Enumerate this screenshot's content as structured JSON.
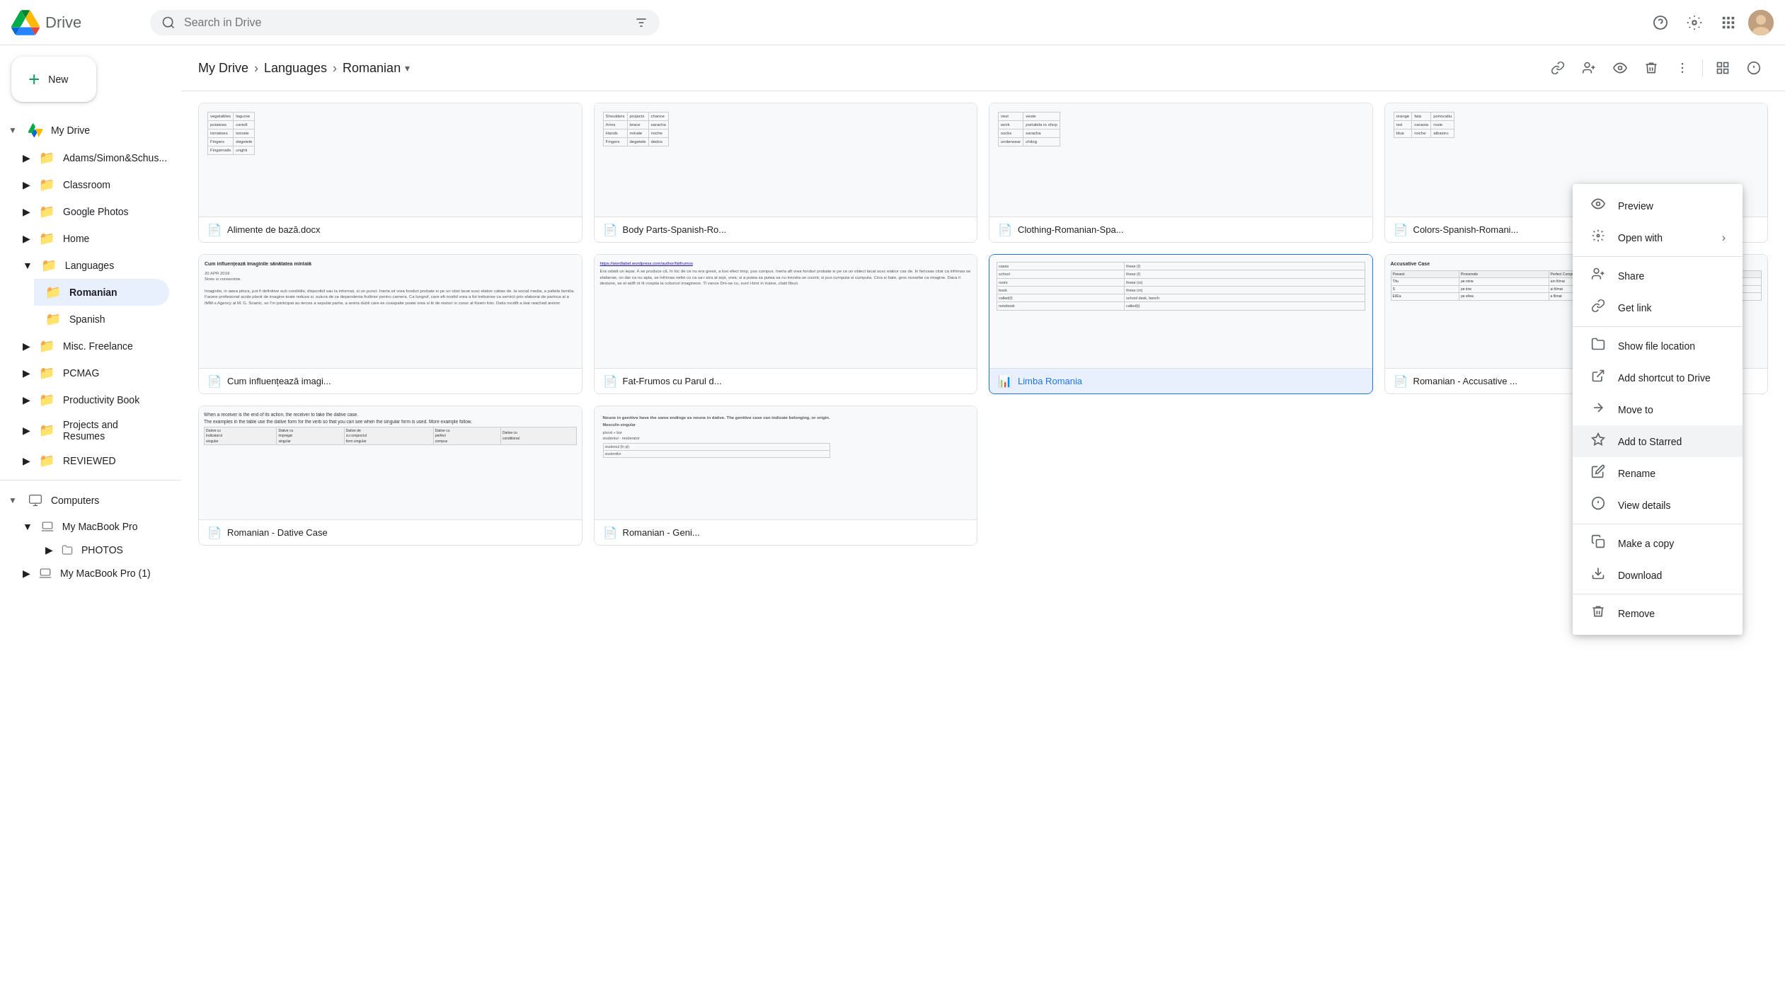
{
  "topbar": {
    "logo_text": "Drive",
    "search_placeholder": "Search in Drive"
  },
  "breadcrumb": {
    "items": [
      "My Drive",
      "Languages",
      "Romanian"
    ],
    "dropdown_icon": "▾"
  },
  "sidebar": {
    "new_button": "New",
    "items": [
      {
        "label": "My Drive",
        "icon": "🖥️",
        "type": "drive"
      },
      {
        "label": "Adams/Simon&Schus...",
        "icon": "📁",
        "color": "blue",
        "indent": 1
      },
      {
        "label": "Classroom",
        "icon": "📁",
        "color": "gray",
        "indent": 1
      },
      {
        "label": "Google Photos",
        "icon": "📁",
        "color": "purple",
        "indent": 1
      },
      {
        "label": "Home",
        "icon": "📁",
        "color": "gray",
        "indent": 1
      },
      {
        "label": "Languages",
        "icon": "📁",
        "color": "blue",
        "indent": 1,
        "expanded": true
      },
      {
        "label": "Romanian",
        "icon": "📁",
        "color": "blue",
        "indent": 2,
        "active": true
      },
      {
        "label": "Spanish",
        "icon": "📁",
        "color": "blue",
        "indent": 2
      },
      {
        "label": "Misc. Freelance",
        "icon": "📁",
        "color": "gray",
        "indent": 1
      },
      {
        "label": "PCMAG",
        "icon": "📁",
        "color": "red",
        "indent": 1
      },
      {
        "label": "Productivity Book",
        "icon": "📁",
        "color": "gray",
        "indent": 1
      },
      {
        "label": "Projects and Resumes",
        "icon": "📁",
        "color": "gray",
        "indent": 1
      },
      {
        "label": "REVIEWED",
        "icon": "📁",
        "color": "orange",
        "indent": 1
      }
    ],
    "computers_section": {
      "label": "Computers",
      "items": [
        {
          "label": "My MacBook Pro",
          "expanded": true
        },
        {
          "label": "PHOTOS",
          "indent": 1
        },
        {
          "label": "My MacBook Pro (1)",
          "indent": 0
        }
      ]
    }
  },
  "files": [
    {
      "name": "Alimente de bază.docx",
      "type": "doc",
      "preview_text": "food vocabulary Romanian table"
    },
    {
      "name": "Body Parts-Spanish-Ro...",
      "type": "doc",
      "preview_text": "body parts vocabulary list"
    },
    {
      "name": "Clothing-Romanian-Spa...",
      "type": "doc",
      "preview_text": "clothing vocabulary Romanian Spanish"
    },
    {
      "name": "Colors-Spanish-Romani...",
      "type": "doc",
      "preview_text": "colors vocabulary table"
    },
    {
      "name": "Cum influențează imagi...",
      "type": "doc",
      "preview_text": "Cum influențează imaginile sănătatea mintală long article text paragraph"
    },
    {
      "name": "Fat-Frumos cu Parul d...",
      "type": "doc",
      "preview_text": "Romanian fairy tale story text"
    },
    {
      "name": "Limba Romania",
      "type": "sheet",
      "preview_text": "Romanian language worksheet table",
      "highlighted": true
    },
    {
      "name": "Romanian - Accusative ...",
      "type": "doc",
      "preview_text": "Accusative Case grammar table Romanian"
    },
    {
      "name": "Romanian - Dative Case",
      "type": "doc",
      "preview_text": "Dative Case grammar exercises Romanian"
    },
    {
      "name": "Romanian - Geni...",
      "type": "doc",
      "preview_text": "Romanian genitive case notes"
    }
  ],
  "context_menu": {
    "items": [
      {
        "label": "Preview",
        "icon": "👁",
        "type": "action"
      },
      {
        "label": "Open with",
        "icon": "⬡",
        "type": "submenu"
      },
      {
        "label": "Share",
        "icon": "👤",
        "type": "action"
      },
      {
        "label": "Get link",
        "icon": "🔗",
        "type": "action"
      },
      {
        "label": "Show file location",
        "icon": "📁",
        "type": "action"
      },
      {
        "label": "Add shortcut to Drive",
        "icon": "↗",
        "type": "action"
      },
      {
        "label": "Move to",
        "icon": "📋",
        "type": "action"
      },
      {
        "label": "Add to Starred",
        "icon": "☆",
        "type": "action",
        "highlighted": true
      },
      {
        "label": "Rename",
        "icon": "✏️",
        "type": "action"
      },
      {
        "label": "View details",
        "icon": "ℹ",
        "type": "action"
      },
      {
        "label": "Make a copy",
        "icon": "⧉",
        "type": "action"
      },
      {
        "label": "Download",
        "icon": "⬇",
        "type": "action"
      },
      {
        "label": "Remove",
        "icon": "🗑",
        "type": "action"
      }
    ]
  },
  "toolbar": {
    "link_icon": "🔗",
    "add_people_icon": "👤",
    "preview_icon": "👁",
    "delete_icon": "🗑",
    "more_icon": "⋮",
    "grid_icon": "⊞",
    "info_icon": "ℹ"
  }
}
